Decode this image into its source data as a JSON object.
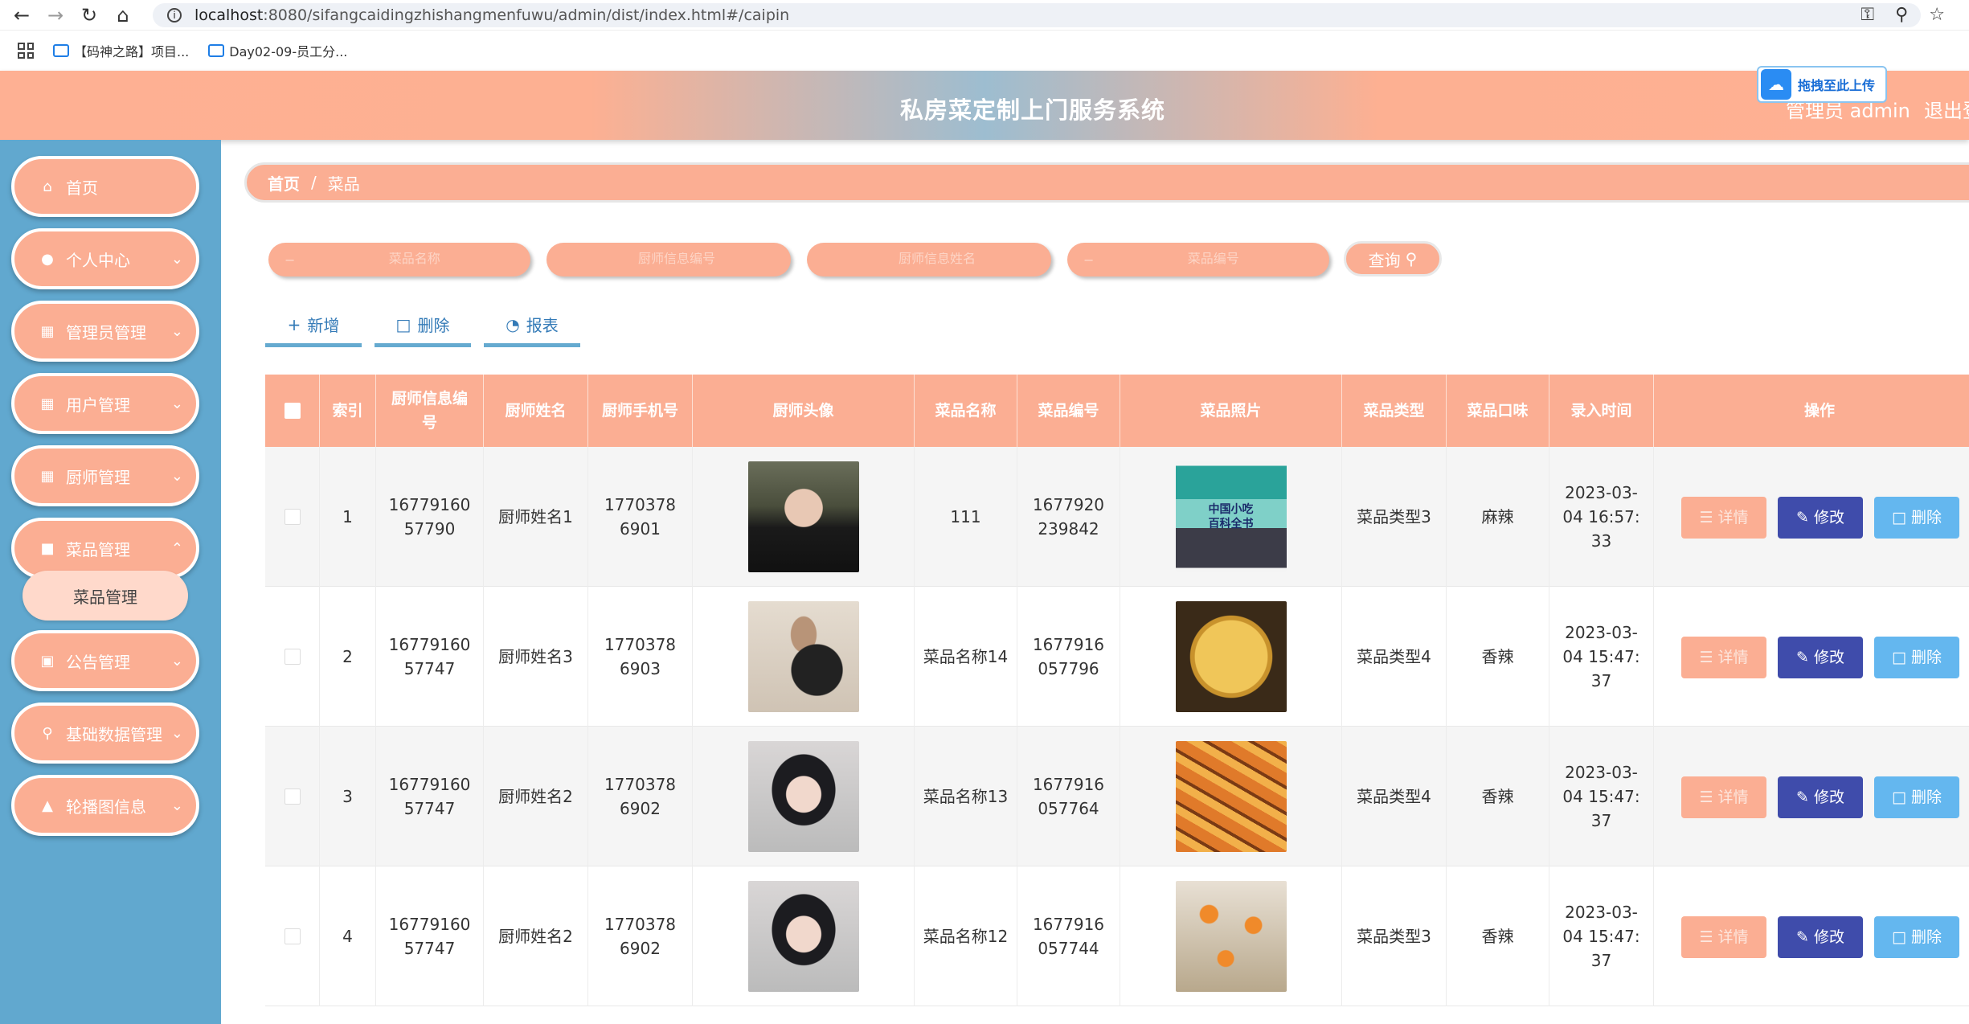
{
  "browser": {
    "url_host": "localhost",
    "url_rest": ":8080/sifangcaidingzhishangmenfuwu/admin/dist/index.html#/caipin",
    "bookmarks": [
      "【码神之路】项目...",
      "Day02-09-员工分..."
    ]
  },
  "header": {
    "title": "私房菜定制上门服务系统",
    "admin": "管理员 admin",
    "logout": "退出登",
    "upload_badge": "拖拽至此上传"
  },
  "sidebar": {
    "items": [
      {
        "label": "首页",
        "icon": "home-icon"
      },
      {
        "label": "个人中心",
        "icon": "user-icon"
      },
      {
        "label": "管理员管理",
        "icon": "grid-icon"
      },
      {
        "label": "用户管理",
        "icon": "grid-icon"
      },
      {
        "label": "厨师管理",
        "icon": "grid-icon"
      },
      {
        "label": "菜品管理",
        "icon": "dish-icon"
      },
      {
        "label": "公告管理",
        "icon": "monitor-icon"
      },
      {
        "label": "基础数据管理",
        "icon": "location-icon"
      },
      {
        "label": "轮播图信息",
        "icon": "trophy-icon"
      }
    ],
    "submenu": "菜品管理"
  },
  "breadcrumb": {
    "home": "首页",
    "sep": "/",
    "current": "菜品"
  },
  "search": {
    "placeholders": [
      "菜品名称",
      "厨师信息编号",
      "厨师信息姓名",
      "菜品编号"
    ],
    "query": "查询"
  },
  "actions": {
    "add": "新增",
    "delete": "删除",
    "report": "报表"
  },
  "table": {
    "headers": [
      "索引",
      "厨师信息编号",
      "厨师姓名",
      "厨师手机号",
      "厨师头像",
      "菜品名称",
      "菜品编号",
      "菜品照片",
      "菜品类型",
      "菜品口味",
      "录入时间",
      "操作"
    ],
    "rows": [
      {
        "index": "1",
        "chef_no": "1677916057790",
        "chef_name": "厨师姓名1",
        "phone": "17703786901",
        "dish_name": "111",
        "dish_no": "1677920239842",
        "type": "菜品类型3",
        "taste": "麻辣",
        "time": "2023-03-04 16:57:33"
      },
      {
        "index": "2",
        "chef_no": "1677916057747",
        "chef_name": "厨师姓名3",
        "phone": "17703786903",
        "dish_name": "菜品名称14",
        "dish_no": "1677916057796",
        "type": "菜品类型4",
        "taste": "香辣",
        "time": "2023-03-04 15:47:37"
      },
      {
        "index": "3",
        "chef_no": "1677916057747",
        "chef_name": "厨师姓名2",
        "phone": "17703786902",
        "dish_name": "菜品名称13",
        "dish_no": "1677916057764",
        "type": "菜品类型4",
        "taste": "香辣",
        "time": "2023-03-04 15:47:37"
      },
      {
        "index": "4",
        "chef_no": "1677916057747",
        "chef_name": "厨师姓名2",
        "phone": "17703786902",
        "dish_name": "菜品名称12",
        "dish_no": "1677916057744",
        "type": "菜品类型3",
        "taste": "香辣",
        "time": "2023-03-04 15:47:37"
      }
    ],
    "ops": {
      "detail": "详情",
      "edit": "修改",
      "delete": "删除"
    },
    "book_cover_text": [
      "中国小吃",
      "百科全书"
    ]
  },
  "colors": {
    "accent": "#fbae93",
    "sidebar": "#61a8cf",
    "edit": "#3f4cab",
    "delete": "#64b7ef"
  }
}
